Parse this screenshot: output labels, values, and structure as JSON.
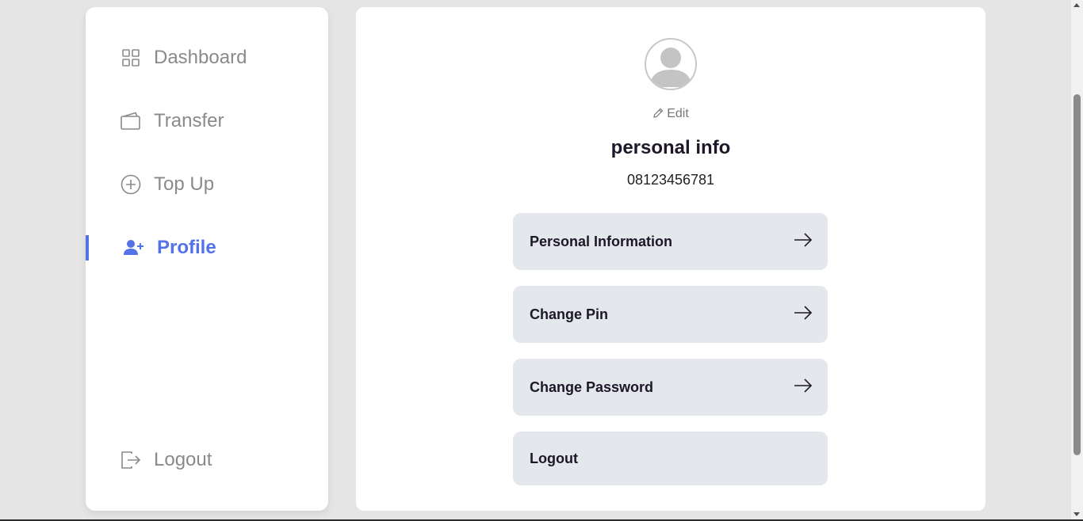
{
  "sidebar": {
    "items": [
      {
        "label": "Dashboard",
        "icon": "grid-icon"
      },
      {
        "label": "Transfer",
        "icon": "wallet-icon"
      },
      {
        "label": "Top Up",
        "icon": "plus-circle-icon"
      },
      {
        "label": "Profile",
        "icon": "user-plus-icon",
        "active": true
      }
    ],
    "logout": {
      "label": "Logout",
      "icon": "logout-icon"
    }
  },
  "profile": {
    "edit_label": "Edit",
    "title": "personal info",
    "phone": "08123456781",
    "menu": [
      {
        "label": "Personal Information",
        "icon": "arrow-right-icon"
      },
      {
        "label": "Change Pin",
        "icon": "arrow-right-icon"
      },
      {
        "label": "Change Password",
        "icon": "arrow-right-icon"
      },
      {
        "label": "Logout"
      }
    ]
  },
  "colors": {
    "accent": "#5472e8",
    "button_bg": "#e4e7ec",
    "muted_text": "#8a8a8a",
    "page_bg": "#e5e5e5"
  }
}
